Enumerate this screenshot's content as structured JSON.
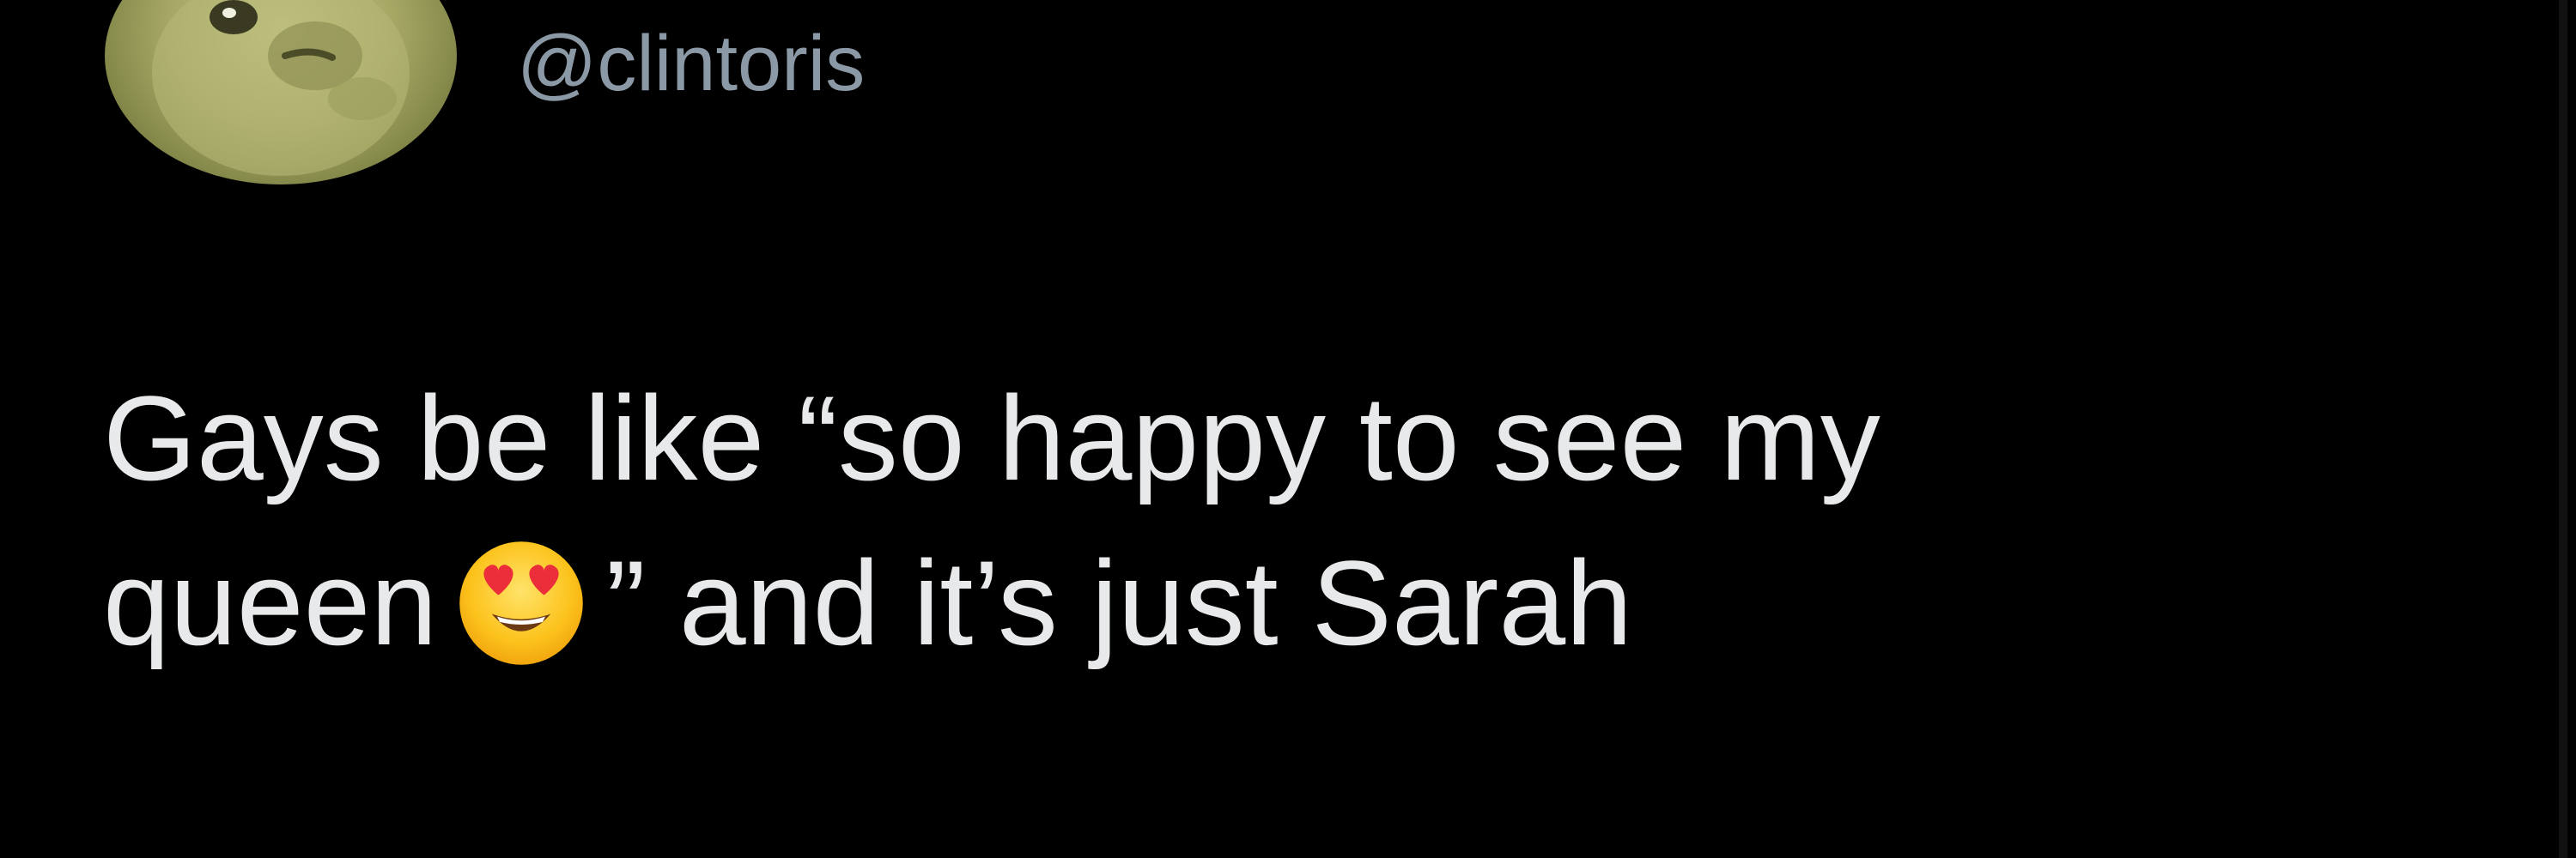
{
  "user": {
    "handle": "@clintoris"
  },
  "tweet": {
    "line1": "Gays be like “so happy to see my",
    "line2_before": "queen",
    "line2_after": "” and it’s just Sarah",
    "emoji_icon": "heart-eyes-emoji-icon"
  },
  "colors": {
    "background": "#000000",
    "text": "#e7e9ea",
    "handle": "#8b98a5"
  }
}
